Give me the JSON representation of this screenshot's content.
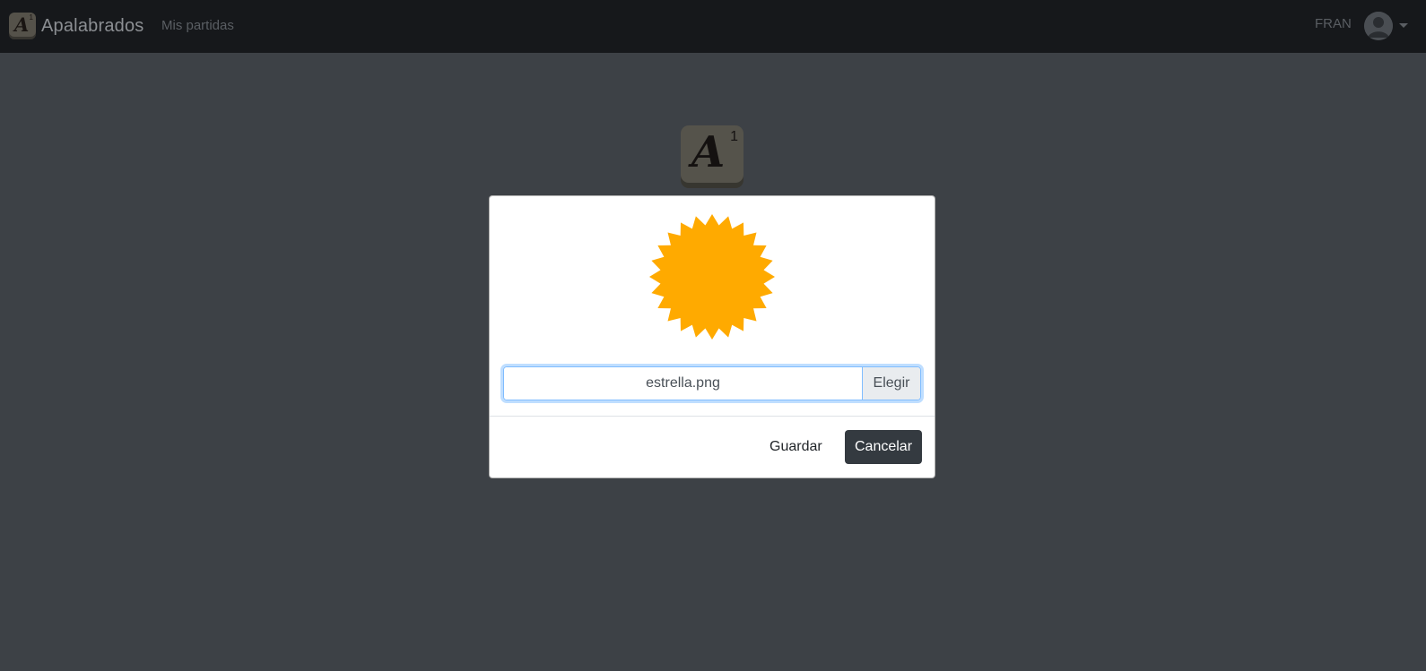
{
  "navbar": {
    "brand_name": "Apalabrados",
    "brand_logo_letter": "A",
    "brand_logo_number": "1",
    "link_my_games": "Mis partidas",
    "user_name": "FRAN"
  },
  "tile": {
    "letter": "A",
    "number": "1"
  },
  "modal": {
    "preview_icon": "orange-star-badge-icon",
    "preview_color": "#ffaa00",
    "file_input": {
      "value": "estrella.png",
      "choose_label": "Elegir"
    },
    "footer": {
      "save_label": "Guardar",
      "cancel_label": "Cancelar"
    }
  },
  "colors": {
    "navbar_bg": "#16181b",
    "page_bg": "#3d4146",
    "cancel_bg": "#343a40",
    "focus_border": "#80bdff"
  }
}
